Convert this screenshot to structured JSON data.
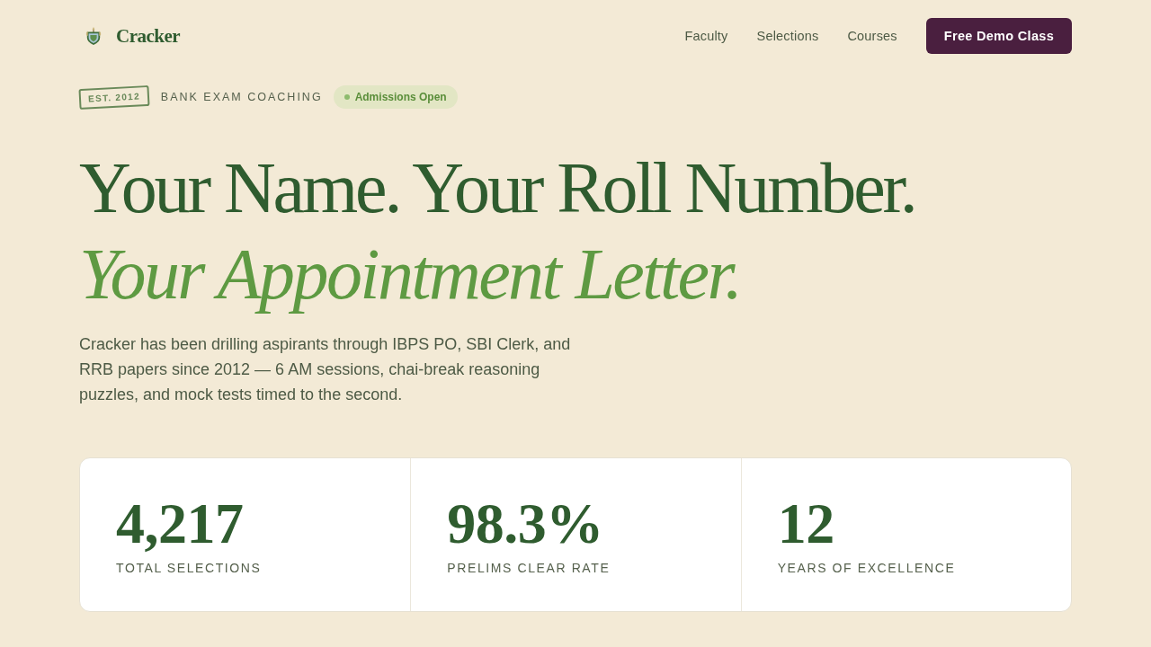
{
  "brand": {
    "name": "Cracker"
  },
  "nav": {
    "links": [
      "Faculty",
      "Selections",
      "Courses"
    ],
    "cta": "Free Demo Class"
  },
  "tags": {
    "stamp": "EST. 2012",
    "label": "BANK EXAM COACHING",
    "badge": "Admissions Open"
  },
  "hero": {
    "title": "Your Name. Your Roll Number.",
    "subtitle": "Your Appointment Letter.",
    "description": "Cracker has been drilling aspirants through IBPS PO, SBI Clerk, and RRB papers since 2012 — 6 AM sessions, chai-break reasoning puzzles, and mock tests timed to the second."
  },
  "stats": [
    {
      "value": "4,217",
      "label": "TOTAL SELECTIONS"
    },
    {
      "value": "98.3%",
      "label": "PRELIMS CLEAR RATE"
    },
    {
      "value": "12",
      "label": "YEARS OF EXCELLENCE"
    }
  ]
}
